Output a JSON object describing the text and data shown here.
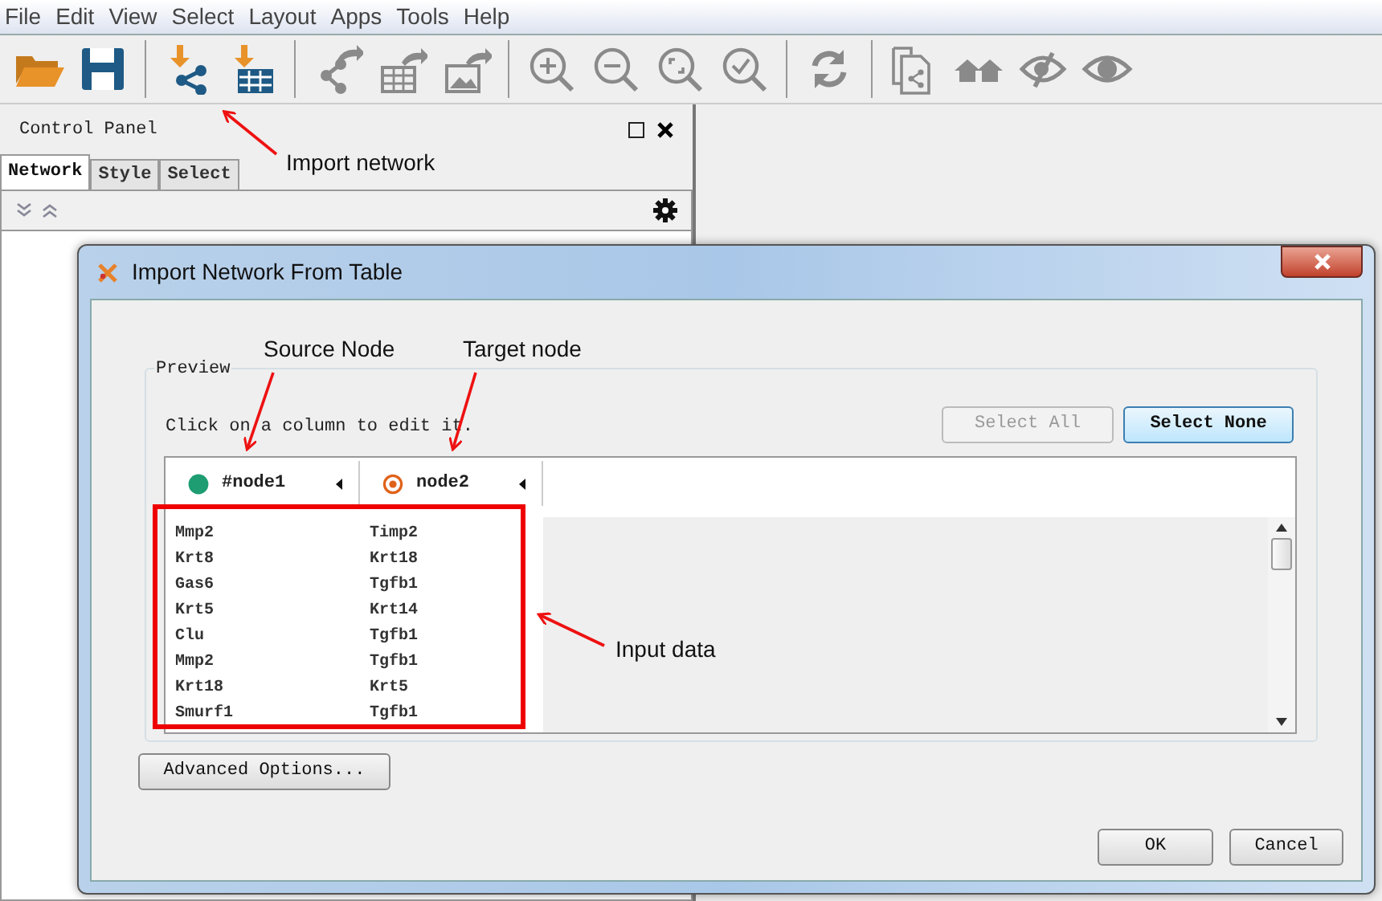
{
  "menu": [
    "File",
    "Edit",
    "View",
    "Select",
    "Layout",
    "Apps",
    "Tools",
    "Help"
  ],
  "toolbar": [
    {
      "kind": "open"
    },
    {
      "kind": "save"
    },
    {
      "kind": "sep"
    },
    {
      "kind": "import-network"
    },
    {
      "kind": "import-table"
    },
    {
      "kind": "sep"
    },
    {
      "kind": "export-network"
    },
    {
      "kind": "export-table"
    },
    {
      "kind": "export-image"
    },
    {
      "kind": "sep"
    },
    {
      "kind": "zoom-in"
    },
    {
      "kind": "zoom-out"
    },
    {
      "kind": "zoom-fit"
    },
    {
      "kind": "zoom-selected"
    },
    {
      "kind": "sep"
    },
    {
      "kind": "refresh"
    },
    {
      "kind": "sep"
    },
    {
      "kind": "copy-network"
    },
    {
      "kind": "houses"
    },
    {
      "kind": "eye-slash"
    },
    {
      "kind": "eye"
    }
  ],
  "control_panel": {
    "title": "Control Panel",
    "tabs": [
      {
        "label": "Network",
        "selected": true
      },
      {
        "label": "Style",
        "selected": false
      },
      {
        "label": "Select",
        "selected": false
      }
    ]
  },
  "dialog": {
    "title": "Import Network From Table",
    "preview_label": "Preview",
    "instruction": "Click on a column to edit it.",
    "select_all": {
      "label": "Select All",
      "disabled": true
    },
    "select_none": {
      "label": "Select None",
      "disabled": false
    },
    "columns": [
      {
        "name": "#node1",
        "kind": "source"
      },
      {
        "name": "node2",
        "kind": "target"
      }
    ],
    "rows": [
      [
        "Mmp2",
        "Timp2"
      ],
      [
        "Krt8",
        "Krt18"
      ],
      [
        "Gas6",
        "Tgfb1"
      ],
      [
        "Krt5",
        "Krt14"
      ],
      [
        "Clu",
        "Tgfb1"
      ],
      [
        "Mmp2",
        "Tgfb1"
      ],
      [
        "Krt18",
        "Krt5"
      ],
      [
        "Smurf1",
        "Tgfb1"
      ]
    ],
    "advanced_button": "Advanced Options...",
    "ok_button": "OK",
    "cancel_button": "Cancel"
  },
  "annotations": [
    {
      "text": "Import network"
    },
    {
      "text": "Source Node"
    },
    {
      "text": "Target node"
    },
    {
      "text": "Input data"
    }
  ]
}
